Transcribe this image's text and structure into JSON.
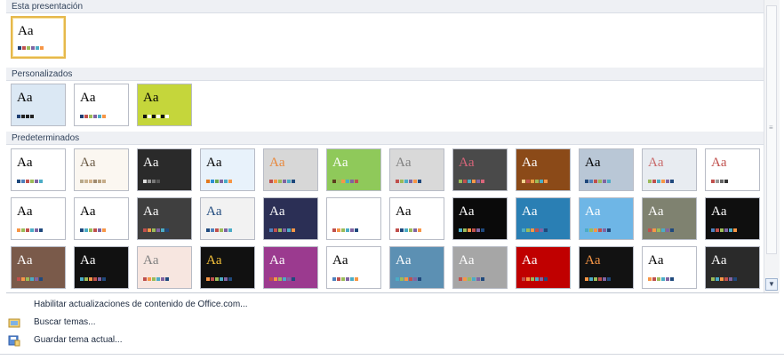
{
  "sections": [
    {
      "key": "current",
      "label": "Esta presentación"
    },
    {
      "key": "custom",
      "label": "Personalizados"
    },
    {
      "key": "builtin",
      "label": "Predeterminados"
    }
  ],
  "thumb_text": "Aa",
  "themes": {
    "current": [
      {
        "name": "theme-current",
        "bg": "#ffffff",
        "fg": "#000000",
        "bar": "#ffffff",
        "sw": [
          "#1f3f73",
          "#c0504d",
          "#9bbb59",
          "#8064a2",
          "#4bacc6",
          "#f79646"
        ],
        "selected": true
      }
    ],
    "custom": [
      {
        "name": "custom-1",
        "bg": "#dbe8f4",
        "fg": "#000000",
        "sw": [
          "#1f3f73",
          "#222222",
          "#222222",
          "#222222"
        ]
      },
      {
        "name": "custom-2",
        "bg": "#ffffff",
        "fg": "#000000",
        "sw": [
          "#1f3f73",
          "#c0504d",
          "#9bbb59",
          "#8064a2",
          "#4bacc6",
          "#f79646"
        ]
      },
      {
        "name": "custom-3",
        "bg": "#c5d63b",
        "fg": "#000000",
        "sw": [
          "#111111",
          "#ffffff",
          "#111111",
          "#ffffff",
          "#111111",
          "#ffffff"
        ]
      }
    ],
    "builtin": [
      {
        "bg": "#ffffff",
        "fg": "#000000",
        "sw": [
          "#1f497d",
          "#4f81bd",
          "#c0504d",
          "#9bbb59",
          "#8064a2",
          "#4bacc6"
        ]
      },
      {
        "bg": "#fbf7f1",
        "fg": "#6a5a45",
        "sw": [
          "#b7a98c",
          "#c7b18f",
          "#d2b28a",
          "#9f8b6f",
          "#b8a17e",
          "#c6ad8a"
        ]
      },
      {
        "bg": "#2a2a2a",
        "fg": "#ffffff",
        "sw": [
          "#dddddd",
          "#999999",
          "#777777",
          "#555555"
        ]
      },
      {
        "bg": "#e8f2fb",
        "fg": "#000000",
        "sw": [
          "#e2791f",
          "#2e8fd6",
          "#6aa84f",
          "#8064a2",
          "#4bacc6",
          "#f79646"
        ]
      },
      {
        "bg": "#d7d7d7",
        "fg": "#e8873a",
        "sw": [
          "#c0504d",
          "#f79646",
          "#9bbb59",
          "#8064a2",
          "#4bacc6",
          "#1f497d"
        ]
      },
      {
        "bg": "#8fc95a",
        "fg": "#ffffff",
        "sw": [
          "#5c3f1d",
          "#9bbb59",
          "#f79646",
          "#4bacc6",
          "#8064a2",
          "#c0504d"
        ]
      },
      {
        "bg": "#d9d9d9",
        "fg": "#7f7f7f",
        "sw": [
          "#c0504d",
          "#9bbb59",
          "#4bacc6",
          "#8064a2",
          "#f79646",
          "#1f497d"
        ]
      },
      {
        "bg": "#4a4a4a",
        "fg": "#d9657a",
        "sw": [
          "#9bbb59",
          "#c0504d",
          "#4bacc6",
          "#f79646",
          "#8064a2",
          "#d9657a"
        ]
      },
      {
        "bg": "#8b4a18",
        "fg": "#ffffff",
        "sw": [
          "#f0d08b",
          "#c0504d",
          "#e8a046",
          "#9bbb59",
          "#4bacc6",
          "#f79646"
        ]
      },
      {
        "bg": "#b9c7d6",
        "fg": "#000000",
        "sw": [
          "#1f497d",
          "#4f81bd",
          "#c0504d",
          "#9bbb59",
          "#8064a2",
          "#4bacc6"
        ]
      },
      {
        "bg": "#e8ecf1",
        "fg": "#c96a6a",
        "sw": [
          "#9bbb59",
          "#c0504d",
          "#4bacc6",
          "#f79646",
          "#8064a2",
          "#1f497d"
        ]
      },
      {
        "bg": "#ffffff",
        "fg": "#c0504d",
        "sw": [
          "#c0504d",
          "#999999",
          "#666666",
          "#333333"
        ]
      },
      {
        "bg": "#ffffff",
        "fg": "#000000",
        "sw": [
          "#f79646",
          "#9bbb59",
          "#c0504d",
          "#4bacc6",
          "#8064a2",
          "#1f497d"
        ]
      },
      {
        "bg": "#ffffff",
        "fg": "#000000",
        "sw": [
          "#1f497d",
          "#4bacc6",
          "#9bbb59",
          "#c0504d",
          "#8064a2",
          "#f79646"
        ]
      },
      {
        "bg": "#3f3f3f",
        "fg": "#ffffff",
        "sw": [
          "#c0504d",
          "#f79646",
          "#9bbb59",
          "#8064a2",
          "#4bacc6",
          "#1f497d"
        ]
      },
      {
        "bg": "#f2f2f2",
        "fg": "#1f497d",
        "sw": [
          "#1f497d",
          "#4f81bd",
          "#c0504d",
          "#9bbb59",
          "#8064a2",
          "#4bacc6"
        ]
      },
      {
        "bg": "#2b2f55",
        "fg": "#ffffff",
        "sw": [
          "#4f81bd",
          "#c0504d",
          "#9bbb59",
          "#8064a2",
          "#4bacc6",
          "#f79646"
        ]
      },
      {
        "bg": "#ffffff",
        "fg": "#ffffff",
        "sw": [
          "#c0504d",
          "#f79646",
          "#9bbb59",
          "#4bacc6",
          "#8064a2",
          "#1f497d"
        ]
      },
      {
        "bg": "#ffffff",
        "fg": "#000000",
        "sw": [
          "#c0504d",
          "#1f497d",
          "#4bacc6",
          "#9bbb59",
          "#8064a2",
          "#f79646"
        ]
      },
      {
        "bg": "#0a0a0a",
        "fg": "#ffffff",
        "sw": [
          "#4bacc6",
          "#9bbb59",
          "#f79646",
          "#c0504d",
          "#8064a2",
          "#1f497d"
        ]
      },
      {
        "bg": "#2a7fb4",
        "fg": "#ffffff",
        "sw": [
          "#4bacc6",
          "#9bbb59",
          "#f79646",
          "#c0504d",
          "#8064a2",
          "#1f497d"
        ]
      },
      {
        "bg": "#6eb6e6",
        "fg": "#ffffff",
        "sw": [
          "#4bacc6",
          "#9bbb59",
          "#f79646",
          "#c0504d",
          "#8064a2",
          "#1f497d"
        ]
      },
      {
        "bg": "#7f8270",
        "fg": "#ffffff",
        "sw": [
          "#c0504d",
          "#f79646",
          "#9bbb59",
          "#4bacc6",
          "#8064a2",
          "#1f497d"
        ]
      },
      {
        "bg": "#0f0f0f",
        "fg": "#ffffff",
        "sw": [
          "#4f81bd",
          "#c0504d",
          "#9bbb59",
          "#8064a2",
          "#4bacc6",
          "#f79646"
        ]
      },
      {
        "bg": "#7a5a4a",
        "fg": "#ffffff",
        "sw": [
          "#c0504d",
          "#f79646",
          "#9bbb59",
          "#4bacc6",
          "#8064a2",
          "#1f497d"
        ]
      },
      {
        "bg": "#111111",
        "fg": "#ffffff",
        "sw": [
          "#4bacc6",
          "#9bbb59",
          "#f79646",
          "#c0504d",
          "#8064a2",
          "#1f497d"
        ]
      },
      {
        "bg": "#f7e6e0",
        "fg": "#7f7f7f",
        "sw": [
          "#c0504d",
          "#f79646",
          "#9bbb59",
          "#4bacc6",
          "#8064a2",
          "#1f497d"
        ]
      },
      {
        "bg": "#111111",
        "fg": "#f7c33a",
        "sw": [
          "#f79646",
          "#c0504d",
          "#9bbb59",
          "#4bacc6",
          "#8064a2",
          "#1f497d"
        ]
      },
      {
        "bg": "#9b3a8f",
        "fg": "#ffffff",
        "sw": [
          "#c0504d",
          "#f79646",
          "#9bbb59",
          "#4bacc6",
          "#8064a2",
          "#1f497d"
        ]
      },
      {
        "bg": "#ffffff",
        "fg": "#000000",
        "sw": [
          "#4f81bd",
          "#c0504d",
          "#9bbb59",
          "#8064a2",
          "#4bacc6",
          "#f79646"
        ]
      },
      {
        "bg": "#5c90b3",
        "fg": "#ffffff",
        "sw": [
          "#4bacc6",
          "#9bbb59",
          "#f79646",
          "#c0504d",
          "#8064a2",
          "#1f497d"
        ]
      },
      {
        "bg": "#a6a6a6",
        "fg": "#ffffff",
        "sw": [
          "#c0504d",
          "#f79646",
          "#9bbb59",
          "#4bacc6",
          "#8064a2",
          "#1f497d"
        ]
      },
      {
        "bg": "#c00000",
        "fg": "#ffffff",
        "sw": [
          "#c0504d",
          "#f79646",
          "#9bbb59",
          "#4bacc6",
          "#8064a2",
          "#1f497d"
        ]
      },
      {
        "bg": "#121212",
        "fg": "#f79646",
        "sw": [
          "#f79646",
          "#4bacc6",
          "#9bbb59",
          "#c0504d",
          "#8064a2",
          "#1f497d"
        ]
      },
      {
        "bg": "#ffffff",
        "fg": "#000000",
        "sw": [
          "#f79646",
          "#c0504d",
          "#9bbb59",
          "#4bacc6",
          "#8064a2",
          "#1f497d"
        ]
      },
      {
        "bg": "#2a2a2a",
        "fg": "#ffffff",
        "sw": [
          "#9bbb59",
          "#4bacc6",
          "#f79646",
          "#c0504d",
          "#8064a2",
          "#1f497d"
        ]
      }
    ]
  },
  "menu": [
    {
      "name": "menu-enable-updates",
      "label": "Habilitar actualizaciones de contenido de Office.com...",
      "icon": ""
    },
    {
      "name": "menu-browse-themes",
      "label": "Buscar temas...",
      "icon": "folder-icon"
    },
    {
      "name": "menu-save-theme",
      "label": "Guardar tema actual...",
      "icon": "save-theme-icon"
    }
  ],
  "scrollbar": {
    "down_arrow": "▼"
  }
}
